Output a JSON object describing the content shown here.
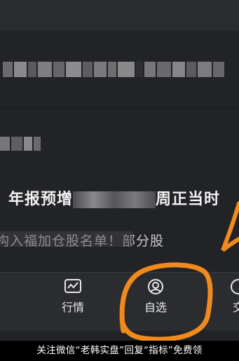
{
  "feed": {
    "headline": "年报预增",
    "headline_tail": "周正当时",
    "subline": "构入福加仓股名单！部分股"
  },
  "bottom_nav": {
    "items": [
      {
        "label": "行情",
        "icon": "chart-line-icon"
      },
      {
        "label": "自选",
        "icon": "user-circle-icon"
      },
      {
        "label": "交",
        "icon": "trade-icon"
      }
    ]
  },
  "footer": {
    "text": "关注微信“老韩实盘”回复“指标”免费领"
  },
  "colors": {
    "background": "#222326",
    "nav_background": "#2b2c30",
    "annotation": "#f08a1d",
    "footer_background": "#000000"
  }
}
